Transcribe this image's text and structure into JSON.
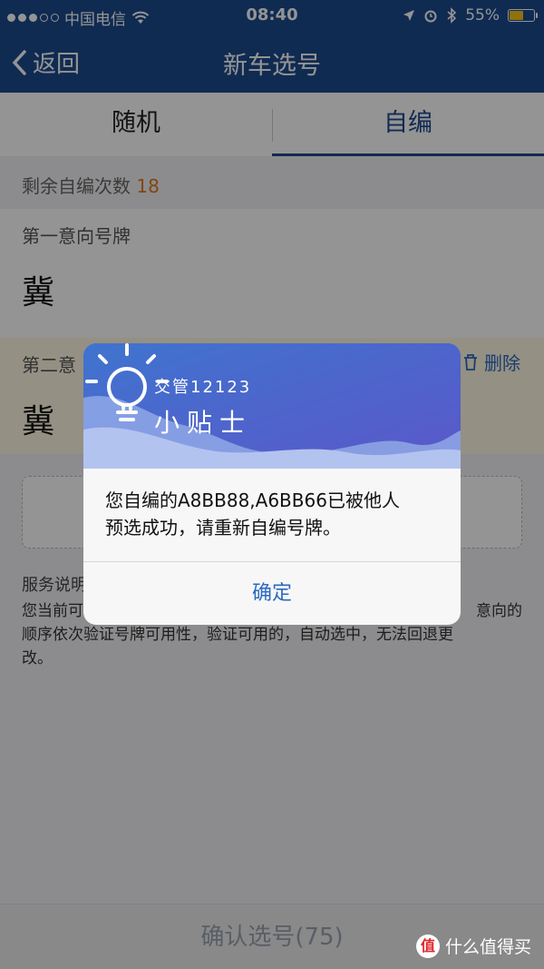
{
  "status_bar": {
    "carrier": "中国电信",
    "time": "08:40",
    "battery": "55%"
  },
  "nav": {
    "back_label": "返回",
    "title": "新车选号"
  },
  "tabs": [
    {
      "label": "随机",
      "active": false
    },
    {
      "label": "自编",
      "active": true
    }
  ],
  "remaining": {
    "label": "剩余自编次数",
    "count": "18"
  },
  "choices": [
    {
      "label": "第一意向号牌",
      "plate": "冀"
    },
    {
      "label": "第二意",
      "plate": "冀",
      "delete_label": "删除"
    }
  ],
  "service": {
    "title": "服务说明",
    "line1_left": "您当前可",
    "line1_right": "意向的",
    "line2": "顺序依次验证号牌可用性，验证可用的，自动选中，无法回退更",
    "line3": "改。"
  },
  "bottom_bar": {
    "confirm_label": "确认选号(75)"
  },
  "dialog": {
    "brand": "交管12123",
    "title": "小贴士",
    "message_line1": "您自编的A8BB88,A6BB66已被他人",
    "message_line2": "预选成功，请重新自编号牌。",
    "ok_label": "确定"
  },
  "watermark": {
    "badge": "值",
    "text": "什么值得买"
  },
  "colors": {
    "header_blue": "#1c4b8e",
    "accent_orange": "#e3771e",
    "link_blue": "#2b6ac2",
    "highlight_bg": "#fff8e2"
  }
}
